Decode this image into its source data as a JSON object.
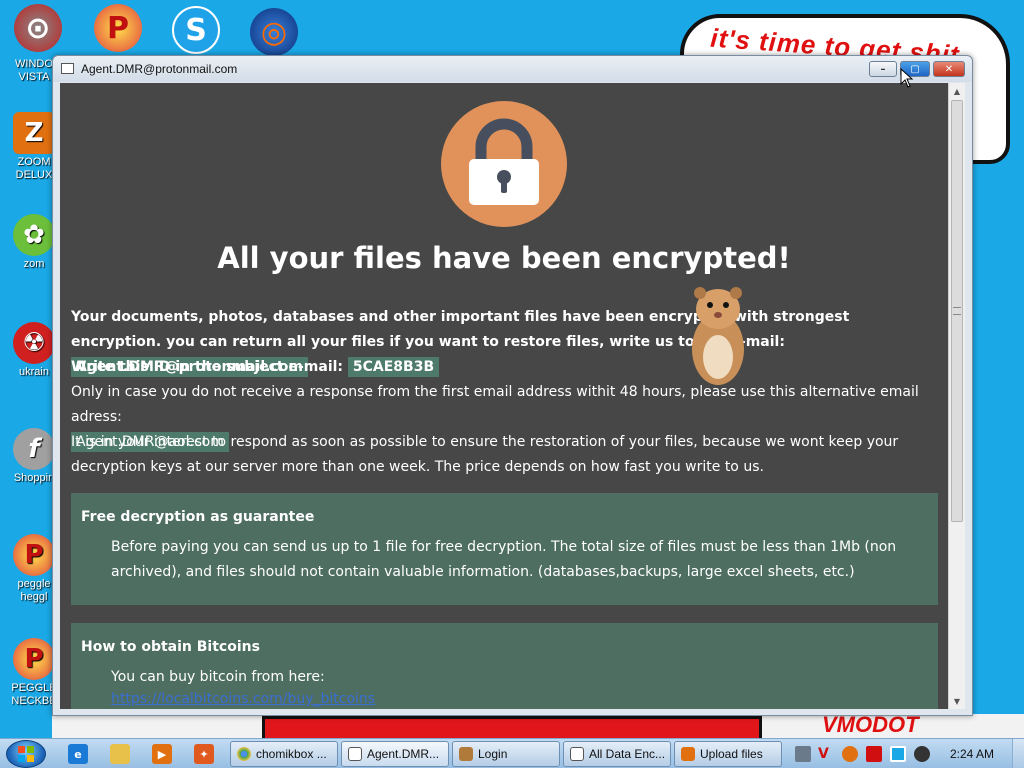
{
  "background": {
    "bubble_text": "it's time to get shit",
    "bottom_tag": "VMODOT"
  },
  "desktop_icons": [
    {
      "label_line1": "WINDO",
      "label_line2": "VISTA",
      "icon": "windows-vista-game-icon",
      "color": "#c02020"
    },
    {
      "label_line1": "ZOOM",
      "label_line2": "DELUX",
      "icon": "zoom-game-icon",
      "color": "#e07010"
    },
    {
      "label_line1": "zom",
      "label_line2": "",
      "icon": "flower-zombie-icon",
      "color": "#ffffff"
    },
    {
      "label_line1": "ukrain",
      "label_line2": "",
      "icon": "radiation-icon",
      "color": "#d02020"
    },
    {
      "label_line1": "Shoppin",
      "label_line2": "",
      "icon": "flash-icon",
      "color": "#a0a0a0"
    },
    {
      "label_line1": "peggle",
      "label_line2": "heggl",
      "icon": "peggle-icon",
      "color": "#e04040"
    },
    {
      "label_line1": "PEGGLE",
      "label_line2": "NECKBE",
      "icon": "peggle-icon",
      "color": "#e04040"
    }
  ],
  "window": {
    "title": "Agent.DMR@protonmail.com",
    "controls": {
      "minimize": "–",
      "maximize": "▢",
      "close": "✕"
    }
  },
  "ransom": {
    "heading": "All your files have been encrypted!",
    "p1_before": "Your documents, photos, databases and other important files have been encrypted with strongest encryption. you can return all your files if you want to restore files, write us to the e-mail: ",
    "email_primary": "Agent.DMR@protonmail.com",
    "p2_label": "Write this ID in the subject e-mail: ",
    "id_code": "5CAE8B3B",
    "p3": "Only in case you do not receive a response from the first email address withit 48 hours, please use this alternative email adress:",
    "email_alt": "Agent.DMR@aol.com",
    "p4": "It is in your interest to respond as soon as possible to ensure the restoration of your files, because we wont keep your decryption keys at our server more than one week. The price depends on how fast you write to us.",
    "section1_title": "Free decryption as guarantee",
    "section1_body": "Before paying you can send us up to 1 file for free decryption. The total size of files must be less than 1Mb (non archived), and files should not contain valuable information. (databases,backups, large excel sheets, etc.)",
    "section2_title": "How to obtain Bitcoins",
    "section2_body": "You can buy bitcoin from here:",
    "section2_link": "https://localbitcoins.com/buy_bitcoins"
  },
  "taskbar": {
    "start": "start",
    "quick_launch": [
      "internet-explorer-icon",
      "folder-icon",
      "media-player-icon",
      "app-icon"
    ],
    "tasks": [
      {
        "label": "chomikbox ...",
        "icon_color": "#3fa34d"
      },
      {
        "label": "Agent.DMR...",
        "icon_color": "#ffffff"
      },
      {
        "label": "Login",
        "icon_color": "#b07a3a"
      },
      {
        "label": "All Data Enc...",
        "icon_color": "#ffffff"
      },
      {
        "label": "Upload files",
        "icon_color": "#e07010"
      }
    ],
    "clock": "2:24 AM"
  },
  "colors": {
    "desktop": "#1aa8e6",
    "window_bg": "#474747",
    "lock_circle": "#e0925a",
    "highlight": "#4e7a6c",
    "section_bg": "#4e6e62"
  }
}
